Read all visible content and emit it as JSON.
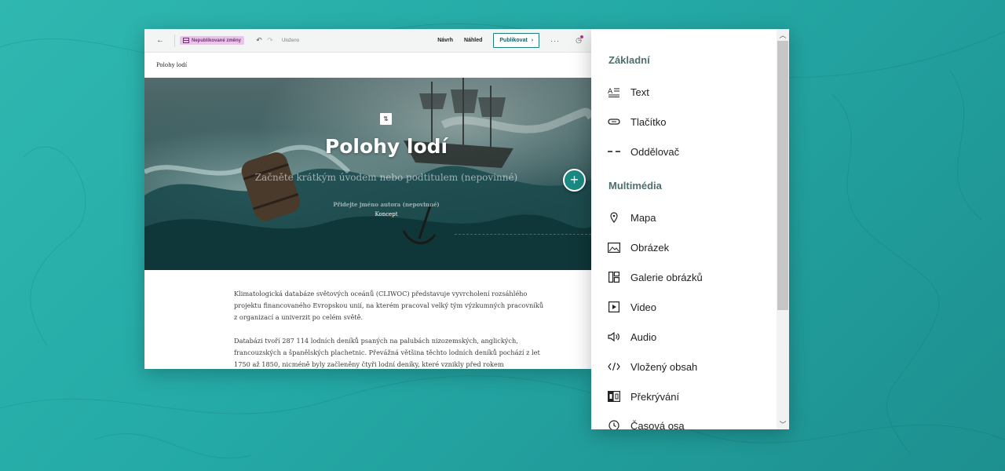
{
  "toolbar": {
    "unpublished_label": "Nepublikované změny",
    "saved_label": "Uloženo",
    "design_label": "Návrh",
    "preview_label": "Náhled",
    "publish_label": "Publikovat"
  },
  "story": {
    "title": "Polohy lodí"
  },
  "hero": {
    "title": "Polohy lodí",
    "subtitle": "Začněte krátkým úvodem nebo podtitulem (nepovinné)",
    "author_placeholder": "Přidejte jméno autora (nepovinné)",
    "status": "Koncept"
  },
  "body": {
    "paragraphs": [
      "Klimatologická databáze světových oceánů (CLIWOC) představuje vyvrcholení rozsáhlého projektu financovaného Evropskou unií, na kterém pracoval velký tým výzkumných pracovníků z organizací a univerzit po celém světě.",
      "Databázi tvoří 287 114 lodních deníků psaných na palubách nizozemských, anglických, francouzských a španělských plachetnic. Převážná většina těchto lodních deníků pochází z let 1750 až 1850, nicméně byly začleněny čtyři lodní deníky, které vznikly před rokem"
    ]
  },
  "panel": {
    "sections": [
      {
        "title": "Základní",
        "items": [
          {
            "label": "Text",
            "icon": "text-icon"
          },
          {
            "label": "Tlačítko",
            "icon": "button-icon"
          },
          {
            "label": "Oddělovač",
            "icon": "separator-icon"
          }
        ]
      },
      {
        "title": "Multimédia",
        "items": [
          {
            "label": "Mapa",
            "icon": "map-pin-icon"
          },
          {
            "label": "Obrázek",
            "icon": "image-icon"
          },
          {
            "label": "Galerie obrázků",
            "icon": "gallery-icon"
          },
          {
            "label": "Video",
            "icon": "video-icon"
          },
          {
            "label": "Audio",
            "icon": "audio-icon"
          },
          {
            "label": "Vložený obsah",
            "icon": "embed-icon"
          },
          {
            "label": "Překrývání",
            "icon": "swipe-icon"
          },
          {
            "label": "Časová osa",
            "icon": "timeline-icon"
          }
        ]
      }
    ]
  },
  "colors": {
    "accent": "#1a8a83",
    "badge_bg": "#e7c7e6",
    "section_title": "#4f6e6e"
  }
}
